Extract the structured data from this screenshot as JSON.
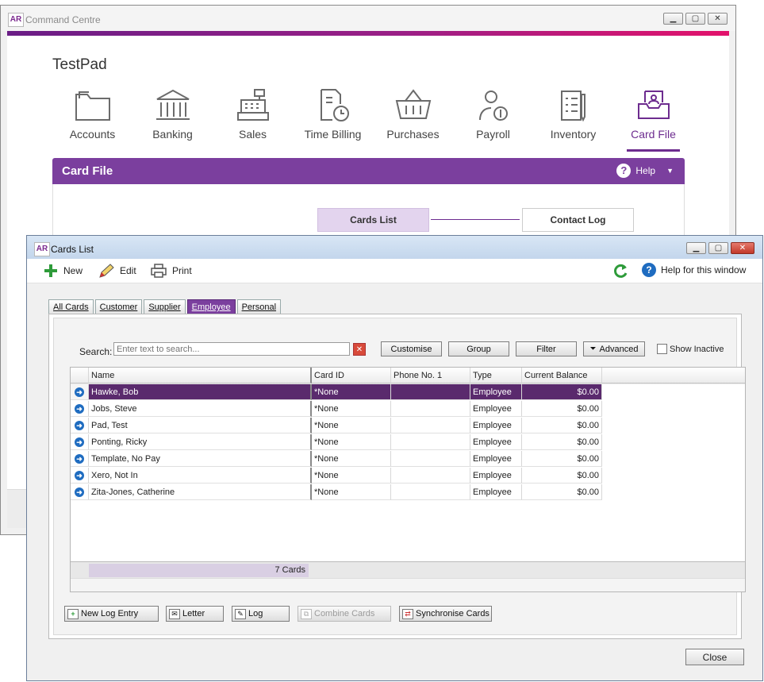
{
  "command_centre": {
    "title": "Command Centre",
    "logo_text": "AR",
    "company": "TestPad",
    "modules": [
      {
        "label": "Accounts",
        "icon": "folder-icon"
      },
      {
        "label": "Banking",
        "icon": "bank-icon"
      },
      {
        "label": "Sales",
        "icon": "cash-register-icon"
      },
      {
        "label": "Time Billing",
        "icon": "time-billing-icon"
      },
      {
        "label": "Purchases",
        "icon": "basket-icon"
      },
      {
        "label": "Payroll",
        "icon": "payroll-icon"
      },
      {
        "label": "Inventory",
        "icon": "inventory-icon"
      },
      {
        "label": "Card File",
        "icon": "card-file-icon",
        "active": true
      }
    ],
    "section_title": "Card File",
    "help_label": "Help",
    "flow": {
      "cards_list": "Cards List",
      "contact_log": "Contact Log"
    }
  },
  "cards_list": {
    "title": "Cards List",
    "logo_text": "AR",
    "toolbar": {
      "new": "New",
      "edit": "Edit",
      "print": "Print",
      "help": "Help for this window"
    },
    "tabs": [
      "All Cards",
      "Customer",
      "Supplier",
      "Employee",
      "Personal"
    ],
    "active_tab": "Employee",
    "search": {
      "label": "Search:",
      "placeholder": "Enter text to search..."
    },
    "filter_buttons": {
      "customise": "Customise",
      "group": "Group",
      "filter": "Filter",
      "advanced": "Advanced"
    },
    "show_inactive": "Show Inactive",
    "columns": [
      "Name",
      "Card ID",
      "Phone No. 1",
      "Type",
      "Current Balance"
    ],
    "rows": [
      {
        "name": "Hawke, Bob",
        "card_id": "*None",
        "phone": "",
        "type": "Employee",
        "balance": "$0.00",
        "selected": true
      },
      {
        "name": "Jobs, Steve",
        "card_id": "*None",
        "phone": "",
        "type": "Employee",
        "balance": "$0.00"
      },
      {
        "name": "Pad, Test",
        "card_id": "*None",
        "phone": "",
        "type": "Employee",
        "balance": "$0.00"
      },
      {
        "name": "Ponting, Ricky",
        "card_id": "*None",
        "phone": "",
        "type": "Employee",
        "balance": "$0.00"
      },
      {
        "name": "Template, No Pay",
        "card_id": "*None",
        "phone": "",
        "type": "Employee",
        "balance": "$0.00"
      },
      {
        "name": "Xero, Not In",
        "card_id": "*None",
        "phone": "",
        "type": "Employee",
        "balance": "$0.00"
      },
      {
        "name": "Zita-Jones, Catherine",
        "card_id": "*None",
        "phone": "",
        "type": "Employee",
        "balance": "$0.00"
      }
    ],
    "card_count": "7 Cards",
    "bottom_buttons": {
      "new_log_entry": "New Log Entry",
      "letter": "Letter",
      "log": "Log",
      "combine_cards": "Combine Cards",
      "synchronise_cards": "Synchronise Cards"
    },
    "close": "Close"
  },
  "colors": {
    "accent_purple": "#7b3f9e",
    "selected_row": "#5a2a6d",
    "accent_magenta": "#e3126b"
  }
}
